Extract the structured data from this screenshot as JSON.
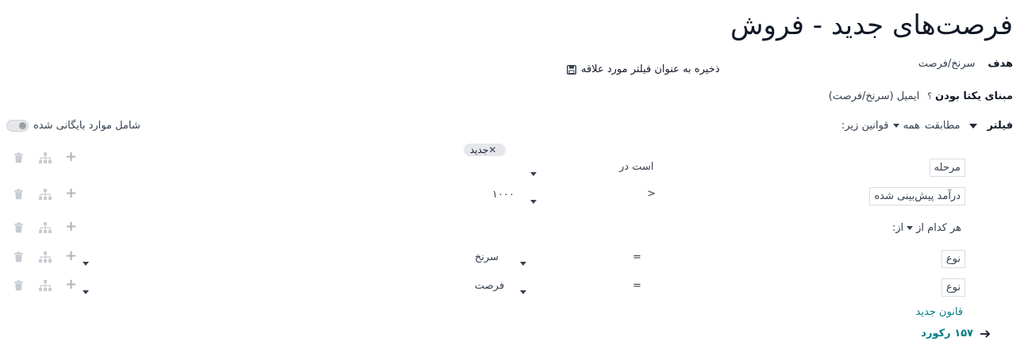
{
  "page": {
    "title": "فرصت‌های جدید - فروش"
  },
  "header": {
    "save_favorite_label": "ذخیره به عنوان فیلتر مورد علاقه",
    "save_icon": "floppy-disk-icon"
  },
  "target": {
    "label": "هدف",
    "value": "سرنخ/فرصت"
  },
  "unique": {
    "label": "مبنای یکتا بودن",
    "help": "؟",
    "value": "ایمیل (سرنخ/فرصت)"
  },
  "filter": {
    "label": "فیلتر",
    "match_word": "مطابقت",
    "match_value": "همه",
    "rules_suffix": "قوانین زیر:",
    "archived_label": "شامل موارد بایگانی شده"
  },
  "rules": [
    {
      "field": "مرحله",
      "operator": "است در",
      "tag": "جدید",
      "value": ""
    },
    {
      "field": "درآمد پیش‌بینی شده",
      "operator": ">",
      "value": "۱۰۰۰"
    }
  ],
  "group": {
    "prefix": "هر کدام از",
    "suffix": "از:",
    "rules": [
      {
        "field": "نوع",
        "operator": "=",
        "value": "سرنخ"
      },
      {
        "field": "نوع",
        "operator": "=",
        "value": "فرصت"
      }
    ]
  },
  "new_rule_label": "قانون جدید",
  "records": {
    "count": "۱۵۷",
    "label": "رکورد"
  },
  "colors": {
    "accent": "#017e84",
    "icon_muted": "#c7ccd1"
  }
}
